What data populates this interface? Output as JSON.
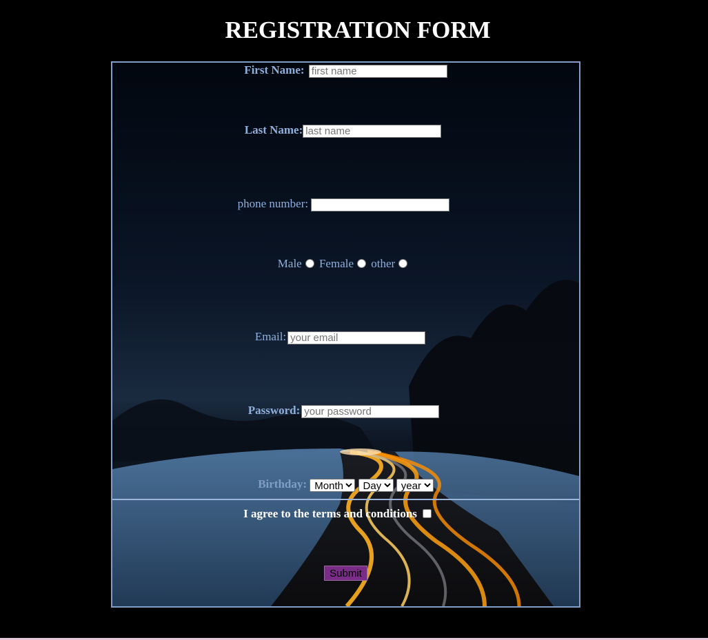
{
  "page": {
    "title": "REGISTRATION FORM"
  },
  "form": {
    "first_name": {
      "label": "First Name:",
      "placeholder": "first name",
      "value": ""
    },
    "last_name": {
      "label": "Last Name:",
      "placeholder": "last name",
      "value": ""
    },
    "phone": {
      "label": "phone number:",
      "placeholder": "",
      "value": ""
    },
    "gender": {
      "options": [
        "Male",
        "Female",
        "other"
      ]
    },
    "email": {
      "label": "Email:",
      "placeholder": "your email",
      "value": ""
    },
    "password": {
      "label": "Password:",
      "placeholder": "your password",
      "value": ""
    },
    "birthday": {
      "label": "Birthday:",
      "month": "Month",
      "day": "Day",
      "year": "year"
    },
    "terms_label": "I agree to the terms and conditions",
    "submit_label": "Submit"
  },
  "colors": {
    "label": "#8fb0dc",
    "frame_border": "#7f9ec8",
    "submit_bg": "#7a2d86"
  }
}
